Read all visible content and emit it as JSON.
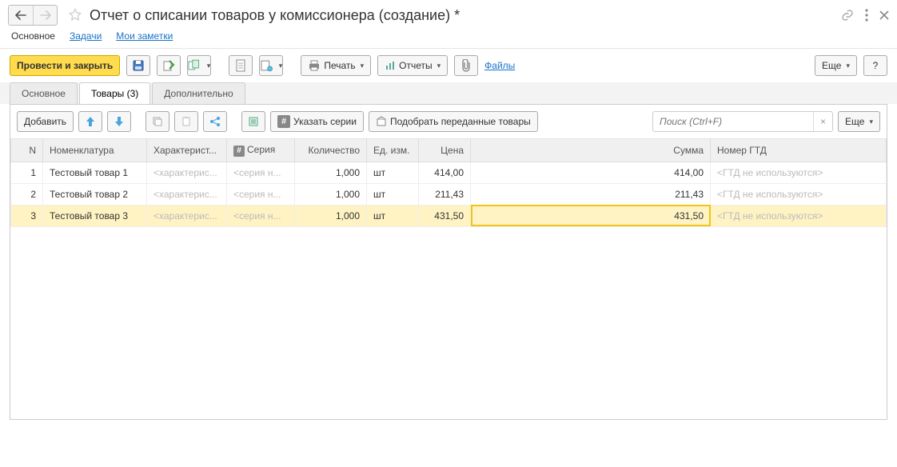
{
  "title": "Отчет о списании товаров у комиссионера (создание) *",
  "nav": {
    "main": "Основное",
    "tasks": "Задачи",
    "notes": "Мои заметки"
  },
  "toolbar": {
    "post_close": "Провести и закрыть",
    "print": "Печать",
    "reports": "Отчеты",
    "files": "Файлы",
    "more": "Еще",
    "help": "?"
  },
  "tabs": {
    "main": "Основное",
    "goods": "Товары (3)",
    "extra": "Дополнительно"
  },
  "inner": {
    "add": "Добавить",
    "set_series": "Указать серии",
    "pick_goods": "Подобрать переданные товары",
    "search_placeholder": "Поиск (Ctrl+F)",
    "more": "Еще"
  },
  "columns": {
    "n": "N",
    "nomen": "Номенклатура",
    "char": "Характерист...",
    "series": "Серия",
    "qty": "Количество",
    "uom": "Ед. изм.",
    "price": "Цена",
    "sum": "Сумма",
    "gtd": "Номер ГТД"
  },
  "placeholders": {
    "char": "<характерис...",
    "series": "<серия н...",
    "gtd": "<ГТД не используются>"
  },
  "rows": [
    {
      "n": "1",
      "nomen": "Тестовый товар 1",
      "qty": "1,000",
      "uom": "шт",
      "price": "414,00",
      "sum": "414,00"
    },
    {
      "n": "2",
      "nomen": "Тестовый товар 2",
      "qty": "1,000",
      "uom": "шт",
      "price": "211,43",
      "sum": "211,43"
    },
    {
      "n": "3",
      "nomen": "Тестовый товар 3",
      "qty": "1,000",
      "uom": "шт",
      "price": "431,50",
      "sum": "431,50"
    }
  ]
}
